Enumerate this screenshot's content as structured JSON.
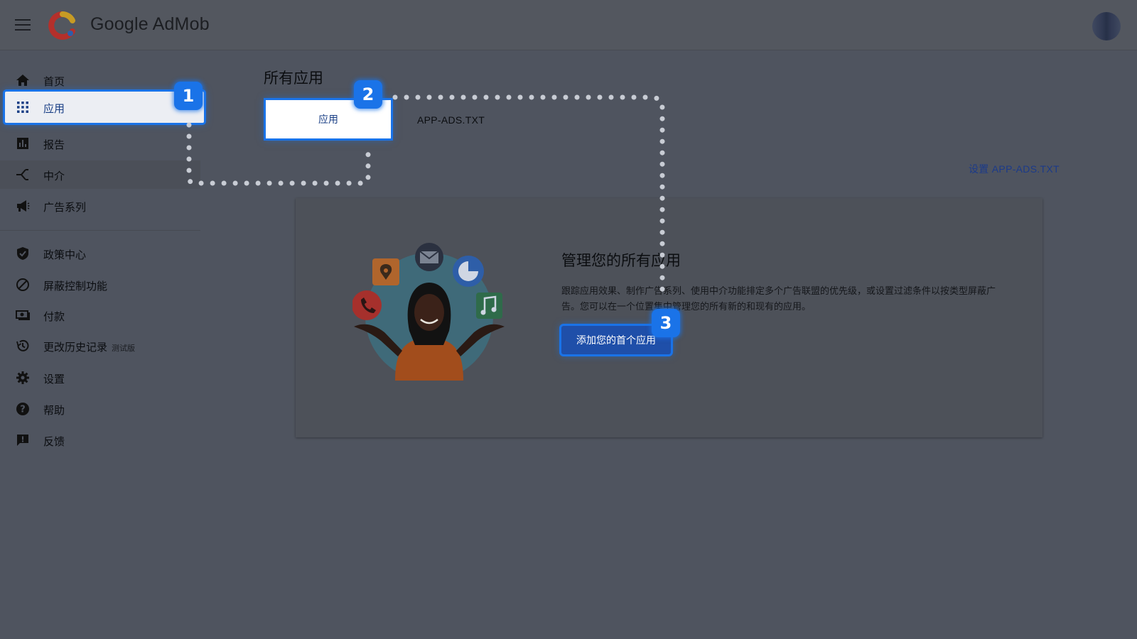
{
  "header": {
    "brand": "Google AdMob",
    "icons": {
      "menu": "menu-icon",
      "logo": "admob-logo-icon",
      "avatar": "user-avatar"
    }
  },
  "sidebar": {
    "items": [
      {
        "label": "首页",
        "icon": "home-icon"
      },
      {
        "label": "应用",
        "icon": "apps-grid-icon"
      },
      {
        "label": "报告",
        "icon": "bar-chart-icon"
      },
      {
        "label": "中介",
        "icon": "mediation-icon"
      },
      {
        "label": "广告系列",
        "icon": "megaphone-icon"
      },
      {
        "label": "政策中心",
        "icon": "shield-check-icon"
      },
      {
        "label": "屏蔽控制功能",
        "icon": "block-icon"
      },
      {
        "label": "付款",
        "icon": "payments-icon"
      },
      {
        "label": "更改历史记录",
        "beta": "测试版",
        "icon": "history-icon"
      },
      {
        "label": "设置",
        "icon": "gear-icon"
      },
      {
        "label": "帮助",
        "icon": "help-icon"
      },
      {
        "label": "反馈",
        "icon": "feedback-icon"
      }
    ],
    "active": "应用"
  },
  "main": {
    "title": "所有应用",
    "tabs": [
      {
        "label": "应用",
        "selected": true
      },
      {
        "label": "APP-ADS.TXT",
        "selected": false
      }
    ],
    "setup_link": "设置 APP-ADS.TXT",
    "card": {
      "title": "管理您的所有应用",
      "description": "跟踪应用效果、制作广告系列、使用中介功能排定多个广告联盟的优先级，或设置过滤条件以按类型屏蔽广告。您可以在一个位置集中管理您的所有新的和现有的应用。",
      "button": "添加您的首个应用"
    }
  },
  "annotations": {
    "badges": [
      "1",
      "2",
      "3"
    ]
  },
  "colors": {
    "accent": "#1a73e8",
    "link": "#1b3a8a",
    "dim_bg": "#4f545f"
  }
}
